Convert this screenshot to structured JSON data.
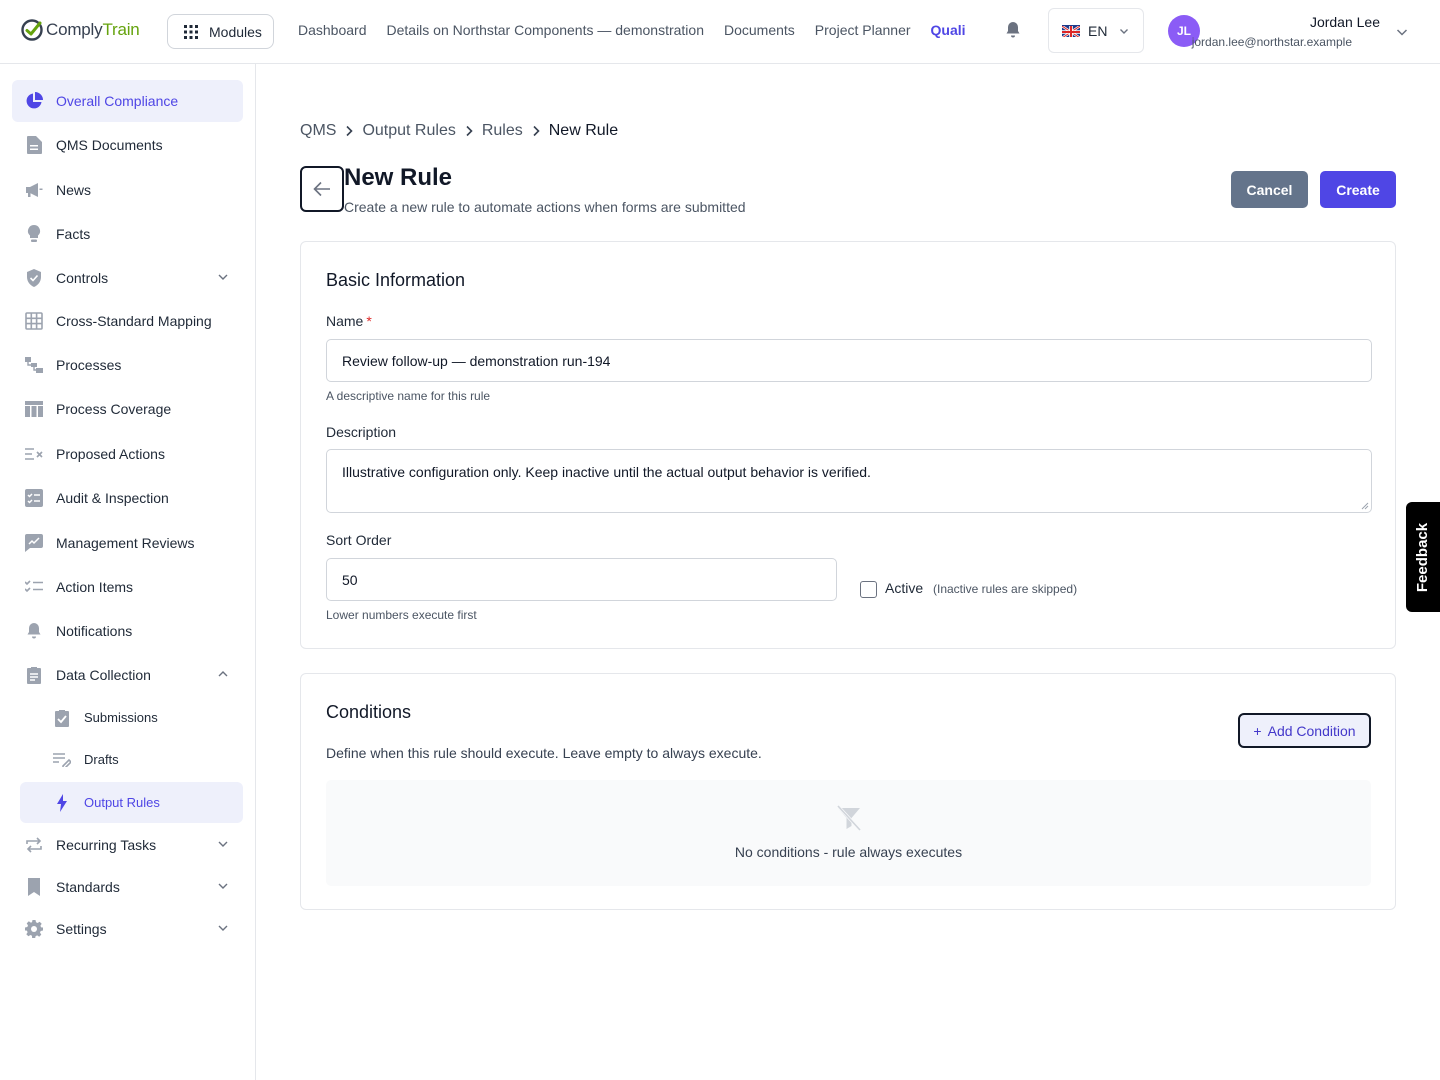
{
  "brand": {
    "part1": "Comply",
    "part2": "Train"
  },
  "topbar": {
    "modules_label": "Modules",
    "nav": [
      "Dashboard",
      "Details on Northstar Components — demonstration",
      "Documents",
      "Project Planner"
    ],
    "nav_active": "Quali",
    "language": "EN",
    "user_initials": "JL",
    "user_name": "Jordan Lee",
    "user_email": "jordan.lee@northstar.example"
  },
  "sidebar": {
    "items": [
      {
        "label": "Overall Compliance",
        "icon": "pie-chart-icon",
        "active": true
      },
      {
        "label": "QMS Documents",
        "icon": "document-icon"
      },
      {
        "label": "News",
        "icon": "megaphone-icon"
      },
      {
        "label": "Facts",
        "icon": "lightbulb-icon"
      },
      {
        "label": "Controls",
        "icon": "shield-icon",
        "chevron": "down"
      },
      {
        "label": "Cross-Standard Mapping",
        "icon": "grid-icon"
      },
      {
        "label": "Processes",
        "icon": "process-icon"
      },
      {
        "label": "Process Coverage",
        "icon": "table-icon"
      },
      {
        "label": "Proposed Actions",
        "icon": "list-x-icon"
      },
      {
        "label": "Audit & Inspection",
        "icon": "checklist-icon"
      },
      {
        "label": "Management Reviews",
        "icon": "chart-edit-icon"
      },
      {
        "label": "Action Items",
        "icon": "list-check-icon"
      },
      {
        "label": "Notifications",
        "icon": "bell-icon"
      },
      {
        "label": "Data Collection",
        "icon": "clipboard-icon",
        "chevron": "up"
      }
    ],
    "sub_items": [
      {
        "label": "Submissions",
        "icon": "clipboard-check-icon"
      },
      {
        "label": "Drafts",
        "icon": "draft-icon"
      },
      {
        "label": "Output Rules",
        "icon": "bolt-icon",
        "active": true
      }
    ],
    "items_bottom": [
      {
        "label": "Recurring Tasks",
        "icon": "repeat-icon",
        "chevron": "down"
      },
      {
        "label": "Standards",
        "icon": "bookmark-icon",
        "chevron": "down"
      },
      {
        "label": "Settings",
        "icon": "gear-icon",
        "chevron": "down"
      }
    ]
  },
  "breadcrumb": [
    "QMS",
    "Output Rules",
    "Rules",
    "New Rule"
  ],
  "page": {
    "title": "New Rule",
    "subtitle": "Create a new rule to automate actions when forms are submitted",
    "cancel_label": "Cancel",
    "create_label": "Create"
  },
  "basic_info": {
    "title": "Basic Information",
    "name_label": "Name",
    "name_required": "*",
    "name_value": "Review follow-up — demonstration run-194",
    "name_hint": "A descriptive name for this rule",
    "description_label": "Description",
    "description_value": "Illustrative configuration only. Keep inactive until the actual output behavior is verified.",
    "sort_label": "Sort Order",
    "sort_value": "50",
    "sort_hint": "Lower numbers execute first",
    "active_label": "Active",
    "active_hint": "(Inactive rules are skipped)",
    "active_checked": false
  },
  "conditions": {
    "title": "Conditions",
    "add_label": "Add Condition",
    "description": "Define when this rule should execute. Leave empty to always execute.",
    "empty_text": "No conditions - rule always executes"
  },
  "feedback_label": "Feedback",
  "colors": {
    "accent": "#4f46e5",
    "cancel": "#64748b",
    "brand_green": "#65a30d"
  }
}
